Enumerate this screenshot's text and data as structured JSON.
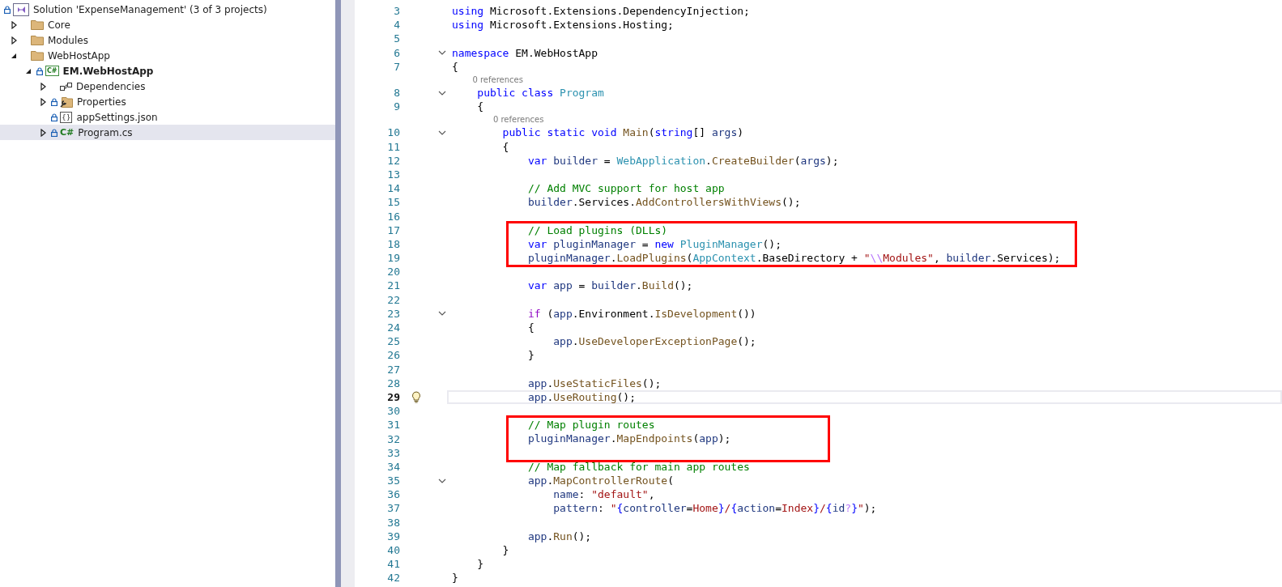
{
  "solution_explorer": {
    "items": [
      {
        "kind": "solution",
        "label": "Solution 'ExpenseManagement' (3 of 3 projects)",
        "locked": true,
        "selected": false,
        "children": [
          {
            "kind": "folder",
            "label": "Core",
            "expanded": false,
            "locked": false,
            "selected": false
          },
          {
            "kind": "folder",
            "label": "Modules",
            "expanded": false,
            "locked": false,
            "selected": false
          },
          {
            "kind": "folder",
            "label": "WebHostApp",
            "expanded": true,
            "locked": false,
            "selected": false,
            "children": [
              {
                "kind": "project",
                "label": "EM.WebHostApp",
                "icon_text": "C#",
                "expanded": true,
                "locked": true,
                "selected": false,
                "children": [
                  {
                    "kind": "dependencies",
                    "label": "Dependencies",
                    "expanded": false,
                    "locked": false,
                    "selected": false
                  },
                  {
                    "kind": "properties",
                    "label": "Properties",
                    "expanded": false,
                    "locked": true,
                    "selected": false
                  },
                  {
                    "kind": "json",
                    "label": "appSettings.json",
                    "icon_text": "{}",
                    "locked": true,
                    "selected": false
                  },
                  {
                    "kind": "csharp",
                    "label": "Program.cs",
                    "icon_text": "C#",
                    "expanded": false,
                    "locked": true,
                    "selected": true
                  }
                ]
              }
            ]
          }
        ]
      }
    ]
  },
  "editor": {
    "segments": [
      {
        "kind": "plain",
        "lines": [
          {
            "kind": "code",
            "n": "3",
            "fold": false,
            "current": false,
            "tokens": [
              {
                "kind": "keyword",
                "text": "using"
              },
              {
                "kind": "plain",
                "text": " Microsoft.Extensions.DependencyInjection;"
              }
            ]
          },
          {
            "kind": "code",
            "n": "4",
            "fold": false,
            "current": false,
            "tokens": [
              {
                "kind": "keyword",
                "text": "using"
              },
              {
                "kind": "plain",
                "text": " Microsoft.Extensions.Hosting;"
              }
            ]
          },
          {
            "kind": "code",
            "n": "5",
            "fold": false,
            "current": false
          },
          {
            "kind": "code",
            "n": "6",
            "fold": true,
            "current": false,
            "tokens": [
              {
                "kind": "keyword",
                "text": "namespace"
              },
              {
                "kind": "plain",
                "text": " EM.WebHostApp"
              }
            ]
          },
          {
            "kind": "code",
            "n": "7",
            "fold": false,
            "current": false,
            "tokens": [
              {
                "kind": "plain",
                "text": "{"
              }
            ]
          },
          {
            "kind": "codelens",
            "text": "0 references"
          },
          {
            "kind": "code",
            "n": "8",
            "fold": true,
            "current": false,
            "tokens": [
              {
                "kind": "keyword",
                "text": "    public class"
              },
              {
                "kind": "type",
                "text": " Program"
              }
            ]
          },
          {
            "kind": "code",
            "n": "9",
            "fold": false,
            "current": false,
            "tokens": [
              {
                "kind": "plain",
                "text": "    {"
              }
            ]
          },
          {
            "kind": "codelens",
            "text": "0 references"
          },
          {
            "kind": "code",
            "n": "10",
            "fold": true,
            "current": false,
            "tokens": [
              {
                "kind": "keyword",
                "text": "        public static void"
              },
              {
                "kind": "method",
                "text": " Main"
              },
              {
                "kind": "plain",
                "text": "("
              },
              {
                "kind": "keyword",
                "text": "string"
              },
              {
                "kind": "plain",
                "text": "[]"
              },
              {
                "kind": "local",
                "text": " args"
              },
              {
                "kind": "plain",
                "text": ")"
              }
            ]
          },
          {
            "kind": "code",
            "n": "11",
            "fold": false,
            "current": false,
            "tokens": [
              {
                "kind": "plain",
                "text": "        {"
              }
            ]
          },
          {
            "kind": "code",
            "n": "12",
            "fold": false,
            "current": false,
            "tokens": [
              {
                "kind": "keyword",
                "text": "            var"
              },
              {
                "kind": "local",
                "text": " builder"
              },
              {
                "kind": "plain",
                "text": " ="
              },
              {
                "kind": "type",
                "text": " WebApplication"
              },
              {
                "kind": "plain",
                "text": "."
              },
              {
                "kind": "method",
                "text": "CreateBuilder"
              },
              {
                "kind": "plain",
                "text": "("
              },
              {
                "kind": "local",
                "text": "args"
              },
              {
                "kind": "plain",
                "text": ");"
              }
            ]
          },
          {
            "kind": "code",
            "n": "13",
            "fold": false,
            "current": false
          },
          {
            "kind": "code",
            "n": "14",
            "fold": false,
            "current": false,
            "tokens": [
              {
                "kind": "comment",
                "text": "            // Add MVC support for host app"
              }
            ]
          },
          {
            "kind": "code",
            "n": "15",
            "fold": false,
            "current": false,
            "tokens": [
              {
                "kind": "local",
                "text": "            builder"
              },
              {
                "kind": "plain",
                "text": ".Services."
              },
              {
                "kind": "method",
                "text": "AddControllersWithViews"
              },
              {
                "kind": "plain",
                "text": "();"
              }
            ]
          },
          {
            "kind": "code",
            "n": "16",
            "fold": false,
            "current": false
          }
        ]
      },
      {
        "kind": "boxed",
        "lines": [
          {
            "kind": "code",
            "n": "17",
            "fold": false,
            "current": false,
            "tokens": [
              {
                "kind": "comment",
                "text": "            // Load plugins (DLLs)"
              }
            ]
          },
          {
            "kind": "code",
            "n": "18",
            "fold": false,
            "current": false,
            "tokens": [
              {
                "kind": "keyword",
                "text": "            var"
              },
              {
                "kind": "local",
                "text": " pluginManager"
              },
              {
                "kind": "plain",
                "text": " ="
              },
              {
                "kind": "keyword",
                "text": " new"
              },
              {
                "kind": "type",
                "text": " PluginManager"
              },
              {
                "kind": "plain",
                "text": "();"
              }
            ]
          },
          {
            "kind": "code",
            "n": "19",
            "fold": false,
            "current": false,
            "tokens": [
              {
                "kind": "local",
                "text": "            pluginManager"
              },
              {
                "kind": "plain",
                "text": "."
              },
              {
                "kind": "method",
                "text": "LoadPlugins"
              },
              {
                "kind": "plain",
                "text": "("
              },
              {
                "kind": "type",
                "text": "AppContext"
              },
              {
                "kind": "plain",
                "text": ".BaseDirectory +"
              },
              {
                "kind": "string",
                "text": " \""
              },
              {
                "kind": "escape",
                "text": "\\\\"
              },
              {
                "kind": "string",
                "text": "Modules\""
              },
              {
                "kind": "plain",
                "text": ","
              },
              {
                "kind": "local",
                "text": " builder"
              },
              {
                "kind": "plain",
                "text": ".Services);"
              }
            ]
          }
        ]
      },
      {
        "kind": "plain",
        "lines": [
          {
            "kind": "code",
            "n": "20",
            "fold": false,
            "current": false
          },
          {
            "kind": "code",
            "n": "21",
            "fold": false,
            "current": false,
            "tokens": [
              {
                "kind": "keyword",
                "text": "            var"
              },
              {
                "kind": "local",
                "text": " app"
              },
              {
                "kind": "plain",
                "text": " ="
              },
              {
                "kind": "local",
                "text": " builder"
              },
              {
                "kind": "plain",
                "text": "."
              },
              {
                "kind": "method",
                "text": "Build"
              },
              {
                "kind": "plain",
                "text": "();"
              }
            ]
          },
          {
            "kind": "code",
            "n": "22",
            "fold": false,
            "current": false
          },
          {
            "kind": "code",
            "n": "23",
            "fold": true,
            "current": false,
            "tokens": [
              {
                "kind": "control",
                "text": "            if"
              },
              {
                "kind": "plain",
                "text": " ("
              },
              {
                "kind": "local",
                "text": "app"
              },
              {
                "kind": "plain",
                "text": ".Environment."
              },
              {
                "kind": "method",
                "text": "IsDevelopment"
              },
              {
                "kind": "plain",
                "text": "())"
              }
            ]
          },
          {
            "kind": "code",
            "n": "24",
            "fold": false,
            "current": false,
            "tokens": [
              {
                "kind": "plain",
                "text": "            {"
              }
            ]
          },
          {
            "kind": "code",
            "n": "25",
            "fold": false,
            "current": false,
            "tokens": [
              {
                "kind": "local",
                "text": "                app"
              },
              {
                "kind": "plain",
                "text": "."
              },
              {
                "kind": "method",
                "text": "UseDeveloperExceptionPage"
              },
              {
                "kind": "plain",
                "text": "();"
              }
            ]
          },
          {
            "kind": "code",
            "n": "26",
            "fold": false,
            "current": false,
            "tokens": [
              {
                "kind": "plain",
                "text": "            }"
              }
            ]
          },
          {
            "kind": "code",
            "n": "27",
            "fold": false,
            "current": false
          },
          {
            "kind": "code",
            "n": "28",
            "fold": false,
            "current": false,
            "tokens": [
              {
                "kind": "local",
                "text": "            app"
              },
              {
                "kind": "plain",
                "text": "."
              },
              {
                "kind": "method",
                "text": "UseStaticFiles"
              },
              {
                "kind": "plain",
                "text": "();"
              }
            ]
          },
          {
            "kind": "code",
            "n": "29",
            "fold": false,
            "current": true,
            "lightbulb": true,
            "tokens": [
              {
                "kind": "local",
                "text": "            app"
              },
              {
                "kind": "plain",
                "text": "."
              },
              {
                "kind": "method",
                "text": "UseRouting"
              },
              {
                "kind": "plain",
                "text": "();"
              }
            ]
          },
          {
            "kind": "code",
            "n": "30",
            "fold": false,
            "current": false
          }
        ]
      },
      {
        "kind": "boxed",
        "lines": [
          {
            "kind": "code",
            "n": "31",
            "fold": false,
            "current": false,
            "tokens": [
              {
                "kind": "comment",
                "text": "            // Map plugin routes"
              }
            ]
          },
          {
            "kind": "code",
            "n": "32",
            "fold": false,
            "current": false,
            "tokens": [
              {
                "kind": "local",
                "text": "            pluginManager"
              },
              {
                "kind": "plain",
                "text": "."
              },
              {
                "kind": "method",
                "text": "MapEndpoints"
              },
              {
                "kind": "plain",
                "text": "("
              },
              {
                "kind": "local",
                "text": "app"
              },
              {
                "kind": "plain",
                "text": ");"
              }
            ]
          },
          {
            "kind": "code",
            "n": "33",
            "fold": false,
            "current": false
          }
        ]
      },
      {
        "kind": "plain",
        "lines": [
          {
            "kind": "code",
            "n": "34",
            "fold": false,
            "current": false,
            "tokens": [
              {
                "kind": "comment",
                "text": "            // Map fallback for main app routes"
              }
            ]
          },
          {
            "kind": "code",
            "n": "35",
            "fold": true,
            "current": false,
            "tokens": [
              {
                "kind": "local",
                "text": "            app"
              },
              {
                "kind": "plain",
                "text": "."
              },
              {
                "kind": "method",
                "text": "MapControllerRoute"
              },
              {
                "kind": "plain",
                "text": "("
              }
            ]
          },
          {
            "kind": "code",
            "n": "36",
            "fold": false,
            "current": false,
            "tokens": [
              {
                "kind": "local",
                "text": "                name"
              },
              {
                "kind": "plain",
                "text": ":"
              },
              {
                "kind": "string",
                "text": " \"default\""
              },
              {
                "kind": "plain",
                "text": ","
              }
            ]
          },
          {
            "kind": "code",
            "n": "37",
            "fold": false,
            "current": false,
            "tokens": [
              {
                "kind": "local",
                "text": "                pattern"
              },
              {
                "kind": "plain",
                "text": ":"
              },
              {
                "kind": "string",
                "text": " \""
              },
              {
                "kind": "brace",
                "text": "{"
              },
              {
                "kind": "local",
                "text": "controller"
              },
              {
                "kind": "plain",
                "text": "="
              },
              {
                "kind": "string",
                "text": "Home"
              },
              {
                "kind": "brace",
                "text": "}"
              },
              {
                "kind": "string",
                "text": "/"
              },
              {
                "kind": "brace",
                "text": "{"
              },
              {
                "kind": "local",
                "text": "action"
              },
              {
                "kind": "plain",
                "text": "="
              },
              {
                "kind": "string",
                "text": "Index"
              },
              {
                "kind": "brace",
                "text": "}"
              },
              {
                "kind": "string",
                "text": "/"
              },
              {
                "kind": "brace",
                "text": "{"
              },
              {
                "kind": "local",
                "text": "id"
              },
              {
                "kind": "escape",
                "text": "?"
              },
              {
                "kind": "brace",
                "text": "}"
              },
              {
                "kind": "string",
                "text": "\""
              },
              {
                "kind": "plain",
                "text": ");"
              }
            ]
          },
          {
            "kind": "code",
            "n": "38",
            "fold": false,
            "current": false
          },
          {
            "kind": "code",
            "n": "39",
            "fold": false,
            "current": false,
            "tokens": [
              {
                "kind": "local",
                "text": "            app"
              },
              {
                "kind": "plain",
                "text": "."
              },
              {
                "kind": "method",
                "text": "Run"
              },
              {
                "kind": "plain",
                "text": "();"
              }
            ]
          },
          {
            "kind": "code",
            "n": "40",
            "fold": false,
            "current": false,
            "tokens": [
              {
                "kind": "plain",
                "text": "        }"
              }
            ]
          },
          {
            "kind": "code",
            "n": "41",
            "fold": false,
            "current": false,
            "tokens": [
              {
                "kind": "plain",
                "text": "    }"
              }
            ]
          },
          {
            "kind": "code",
            "n": "42",
            "fold": false,
            "current": false,
            "tokens": [
              {
                "kind": "plain",
                "text": "}"
              }
            ]
          }
        ]
      }
    ]
  }
}
